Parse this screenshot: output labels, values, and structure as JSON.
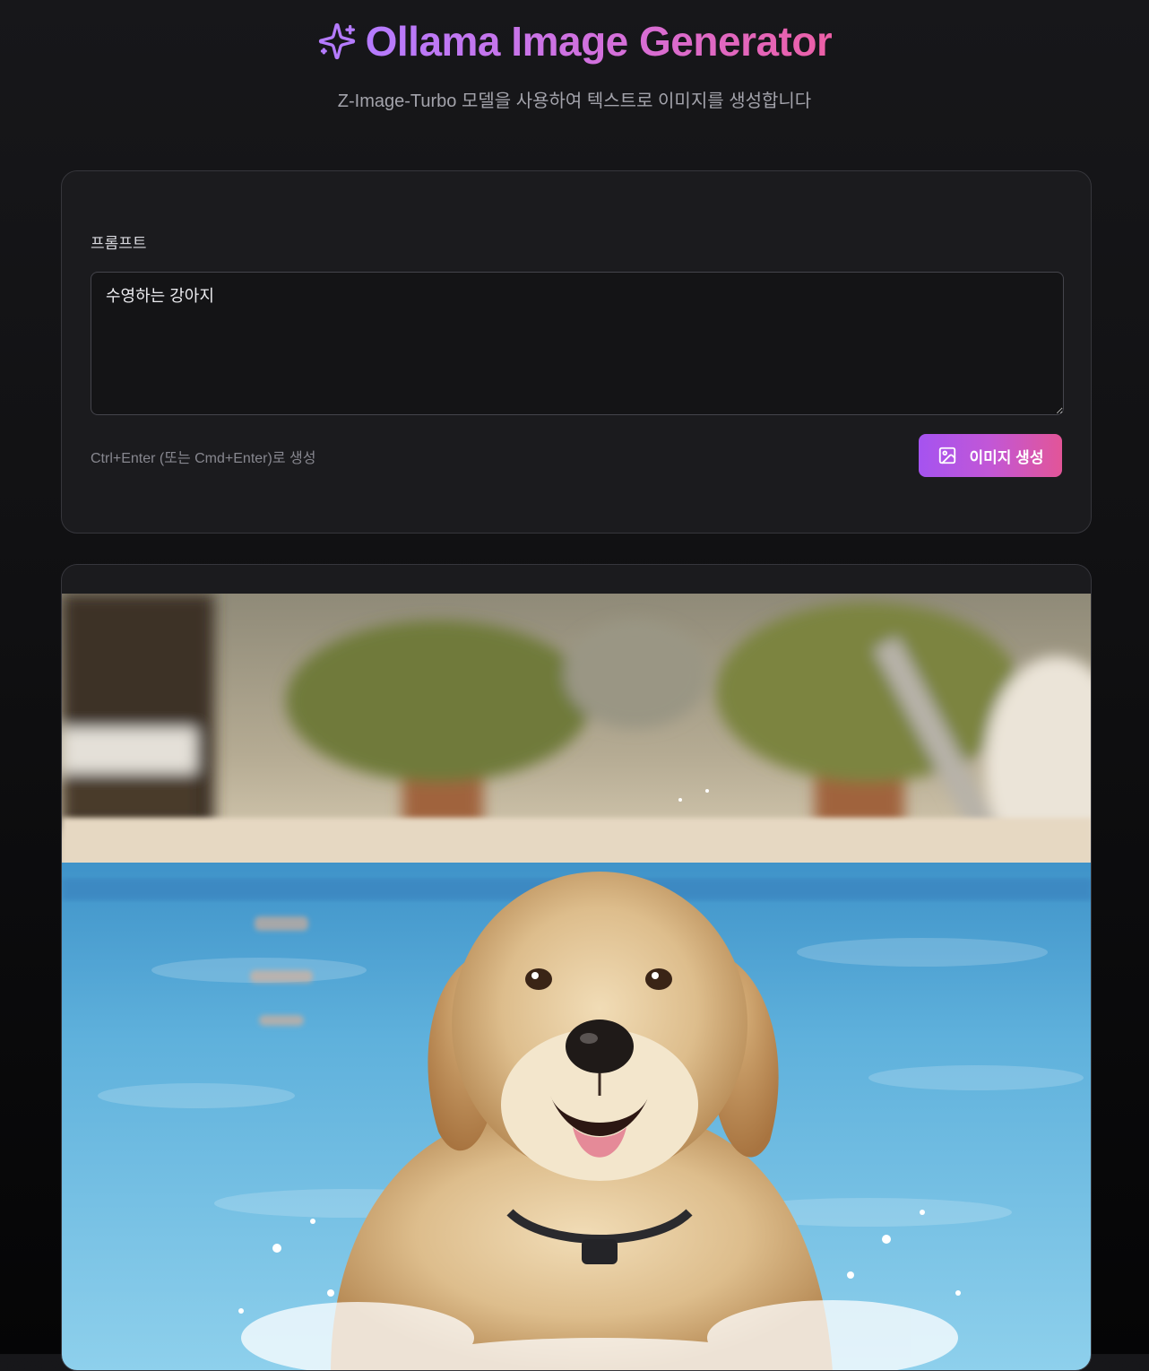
{
  "header": {
    "title": "Ollama Image Generator",
    "subtitle": "Z-Image-Turbo 모델을 사용하여 텍스트로 이미지를 생성합니다",
    "icon": "sparkles-icon",
    "accent_gradient": [
      "#b57bff",
      "#ec5fa6"
    ]
  },
  "prompt_form": {
    "label": "프롬프트",
    "value": "수영하는 강아지",
    "hint": "Ctrl+Enter (또는 Cmd+Enter)로 생성",
    "generate_button": {
      "label": "이미지 생성",
      "icon": "image-icon"
    }
  },
  "result": {
    "image_alt": "수영하는 강아지"
  }
}
